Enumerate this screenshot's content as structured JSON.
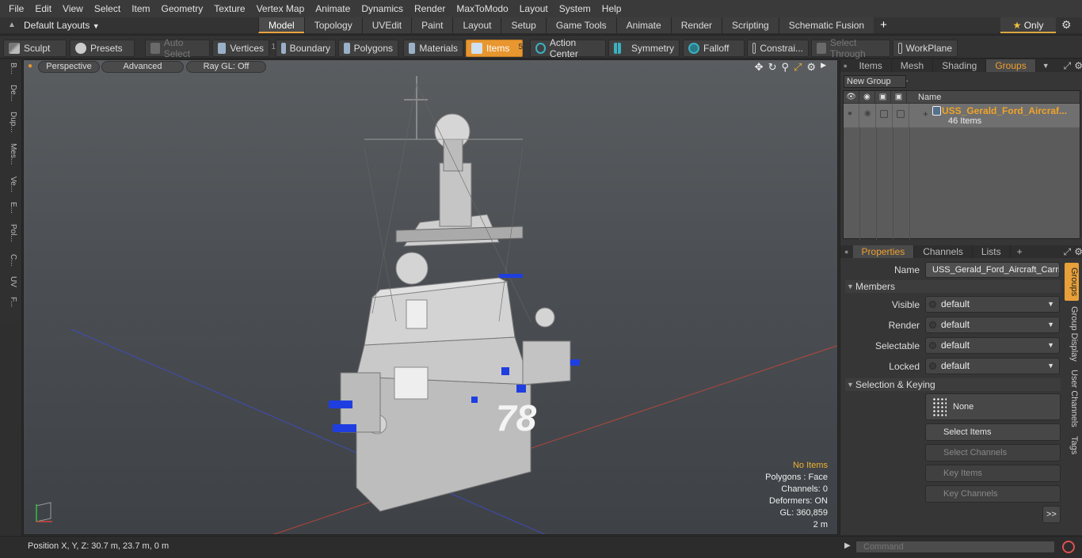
{
  "menu": [
    "File",
    "Edit",
    "View",
    "Select",
    "Item",
    "Geometry",
    "Texture",
    "Vertex Map",
    "Animate",
    "Dynamics",
    "Render",
    "MaxToModo",
    "Layout",
    "System",
    "Help"
  ],
  "layouts_label": "Default Layouts",
  "tabs": [
    {
      "label": "Model",
      "active": true
    },
    {
      "label": "Topology",
      "active": false
    },
    {
      "label": "UVEdit",
      "active": false
    },
    {
      "label": "Paint",
      "active": false
    },
    {
      "label": "Layout",
      "active": false
    },
    {
      "label": "Setup",
      "active": false
    },
    {
      "label": "Game Tools",
      "active": false
    },
    {
      "label": "Animate",
      "active": false
    },
    {
      "label": "Render",
      "active": false
    },
    {
      "label": "Scripting",
      "active": false
    },
    {
      "label": "Schematic Fusion",
      "active": false
    }
  ],
  "tab_add": "+",
  "only_label": "Only",
  "toolbar": {
    "sculpt": "Sculpt",
    "presets": "Presets",
    "auto_select": "Auto Select",
    "vertices": "Vertices",
    "vertices_count": "1",
    "boundary": "Boundary",
    "polygons": "Polygons",
    "materials": "Materials",
    "items": "Items",
    "items_count": "5",
    "action_center": "Action Center",
    "symmetry": "Symmetry",
    "falloff": "Falloff",
    "constraints": "Constrai...",
    "select_through": "Select Through",
    "workplane": "WorkPlane"
  },
  "left_tabs": [
    "B...",
    "De...",
    "Dup...",
    "Mes...",
    "Ve...",
    "E...",
    "Pol...",
    "C...",
    "UV",
    "F..."
  ],
  "viewport": {
    "perspective": "Perspective",
    "advanced": "Advanced",
    "raygl": "Ray GL: Off",
    "hull_number": "78",
    "hud": {
      "no_items": "No Items",
      "polygons": "Polygons : Face",
      "channels": "Channels: 0",
      "deformers": "Deformers: ON",
      "gl": "GL: 360,859",
      "scale": "2 m"
    }
  },
  "right_top_tabs": [
    {
      "label": "Items",
      "active": false
    },
    {
      "label": "Mesh ...",
      "active": false
    },
    {
      "label": "Shading",
      "active": false
    },
    {
      "label": "Groups",
      "active": true
    }
  ],
  "groups": {
    "new_group": "New Group",
    "col_name": "Name",
    "item_name": "USS_Gerald_Ford_Aircraf...",
    "item_count": "46 Items"
  },
  "prop_tabs": [
    {
      "label": "Properties",
      "active": true
    },
    {
      "label": "Channels",
      "active": false
    },
    {
      "label": "Lists",
      "active": false
    }
  ],
  "prop_tab_add": "+",
  "properties": {
    "name_label": "Name",
    "name_value": "USS_Gerald_Ford_Aircraft_Carrier",
    "members_section": "Members",
    "visible_label": "Visible",
    "visible_value": "default",
    "render_label": "Render",
    "render_value": "default",
    "selectable_label": "Selectable",
    "selectable_value": "default",
    "locked_label": "Locked",
    "locked_value": "default",
    "selkey_section": "Selection & Keying",
    "none_label": "None",
    "select_items": "Select Items",
    "select_channels": "Select Channels",
    "key_items": "Key Items",
    "key_channels": "Key Channels",
    "more": ">>"
  },
  "side_vtabs": [
    {
      "label": "Groups",
      "active": true
    },
    {
      "label": "Group Display",
      "active": false
    },
    {
      "label": "User Channels",
      "active": false
    },
    {
      "label": "Tags",
      "active": false
    }
  ],
  "status": {
    "position": "Position X, Y, Z:   30.7 m, 23.7 m, 0 m",
    "command_placeholder": "Command"
  },
  "colors": {
    "accent": "#e8962f",
    "group_name": "#f0a428",
    "hud_warn": "#f0b030"
  }
}
